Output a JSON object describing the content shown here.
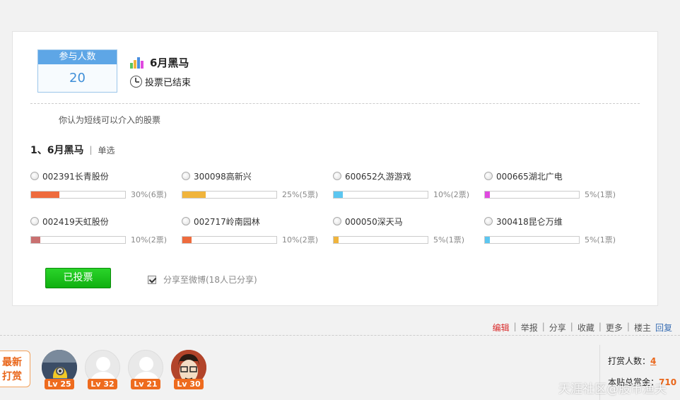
{
  "poll": {
    "participants_label": "参与人数",
    "participants_count": "20",
    "title": "6月黑马",
    "status": "投票已结束",
    "question_desc": "你认为短线可以介入的股票",
    "question_title": "1、6月黑马",
    "question_type": "单选",
    "options": [
      {
        "label": "002391长青股份",
        "percent": 30,
        "result": "30%(6票)",
        "color": "#ee6b3d"
      },
      {
        "label": "300098高新兴",
        "percent": 25,
        "result": "25%(5票)",
        "color": "#f0b43c"
      },
      {
        "label": "600652久游游戏",
        "percent": 10,
        "result": "10%(2票)",
        "color": "#5cc6f0"
      },
      {
        "label": "000665湖北广电",
        "percent": 5,
        "result": "5%(1票)",
        "color": "#e04ae0"
      },
      {
        "label": "002419天虹股份",
        "percent": 10,
        "result": "10%(2票)",
        "color": "#c97070"
      },
      {
        "label": "002717岭南园林",
        "percent": 10,
        "result": "10%(2票)",
        "color": "#ee6b3d"
      },
      {
        "label": "000050深天马",
        "percent": 5,
        "result": "5%(1票)",
        "color": "#f0b43c"
      },
      {
        "label": "300418昆仑万维",
        "percent": 5,
        "result": "5%(1票)",
        "color": "#5cc6f0"
      }
    ],
    "voted_button": "已投票",
    "share_label": "分享至微博(18人已分享)",
    "share_checked": true
  },
  "actions": {
    "edit": "编辑",
    "report": "举报",
    "share": "分享",
    "favorite": "收藏",
    "more": "更多",
    "floor_owner": "楼主",
    "reply": "回复",
    "separator": "|"
  },
  "reward": {
    "tag_line1": "最新",
    "tag_line2": "打赏",
    "users": [
      {
        "level": "Lv 25"
      },
      {
        "level": "Lv 32"
      },
      {
        "level": "Lv 21"
      },
      {
        "level": "Lv 30"
      }
    ],
    "count_label": "打赏人数：",
    "count_value": "4",
    "total_label": "本贴总赏金：",
    "total_value": "710"
  },
  "watermark": "天涯社区@股市渔夫",
  "colors": {
    "accent_orange": "#e9661a",
    "button_green": "#1bc41b",
    "link_blue": "#3a6fb4",
    "edit_red": "#d92b2b"
  }
}
